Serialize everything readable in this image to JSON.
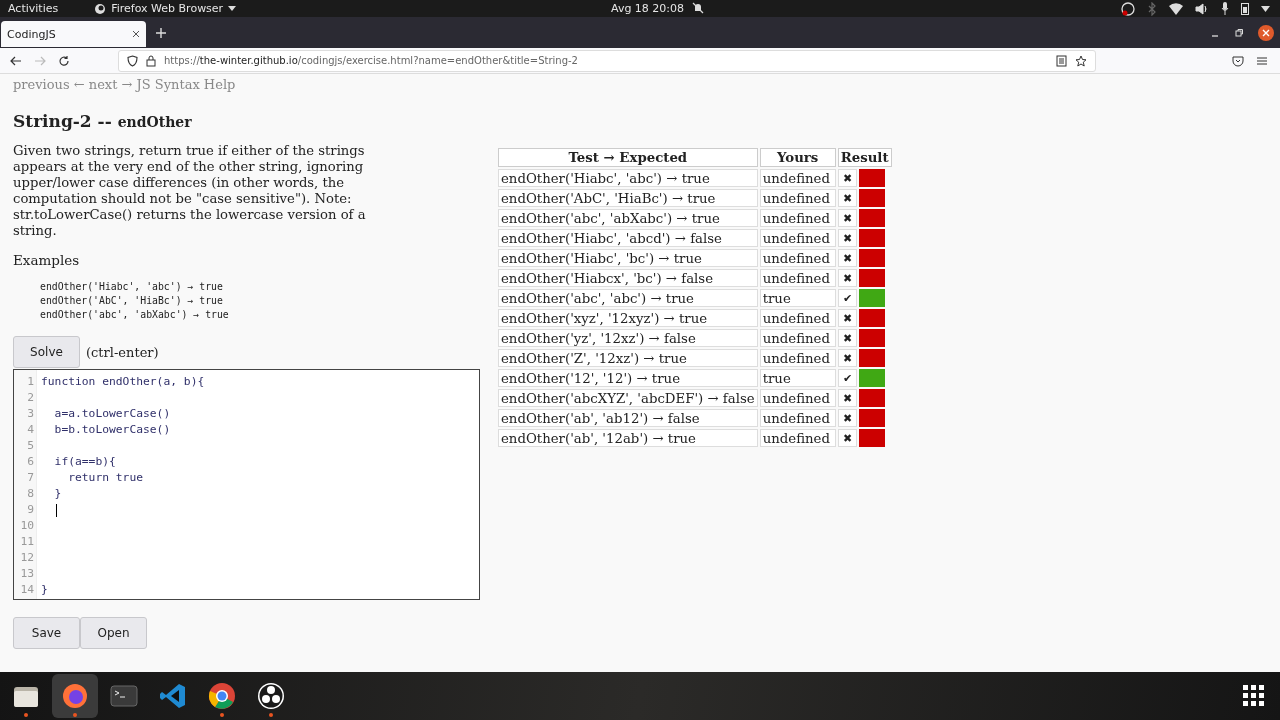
{
  "top_bar": {
    "activities": "Activities",
    "app_menu": "Firefox Web Browser",
    "clock": "Avg 18  20:08"
  },
  "browser": {
    "tabs": [
      {
        "title": "CodingJS",
        "selected": true
      }
    ],
    "url": {
      "scheme": "https://",
      "host": "the-winter.github.io",
      "path": "/codingjs/exercise.html?name=endOther&title=String-2"
    }
  },
  "page": {
    "nav": "previous ← next → JS Syntax Help",
    "title": "String-2 --",
    "title_name": "endOther",
    "description": "Given two strings, return true if either of the strings appears at the very end of the other string, ignoring upper/lower case differences (in other words, the computation should not be \"case sensitive\"). Note: str.toLowerCase() returns the lowercase version of a string.",
    "examples_heading": "Examples",
    "examples": [
      "endOther('Hiabc', 'abc') → true",
      "endOther('AbC', 'HiaBc') → true",
      "endOther('abc', 'abXabc') → true"
    ],
    "solve_button": "Solve",
    "solve_hint": "(ctrl-enter)",
    "editor": {
      "lines": [
        {
          "number": "1",
          "text": "function endOther(a, b){"
        },
        {
          "number": "2"
        },
        {
          "number": "3",
          "text": "  a=a.toLowerCase()"
        },
        {
          "number": "4",
          "text": "  b=b.toLowerCase()"
        },
        {
          "number": "5"
        },
        {
          "number": "6",
          "text": "  if(a==b){"
        },
        {
          "number": "7",
          "text": "    return true"
        },
        {
          "number": "8",
          "text": "  }"
        },
        {
          "number": "9",
          "cursor": true
        },
        {
          "number": "10"
        },
        {
          "number": "11"
        },
        {
          "number": "12"
        },
        {
          "number": "13"
        },
        {
          "number": "14",
          "text": "}"
        }
      ]
    },
    "buttons": [
      "Save",
      "Open"
    ],
    "table": {
      "columns": [
        "Test → Expected",
        "Yours",
        "Result"
      ],
      "rows": [
        {
          "test": "endOther('Hiabc', 'abc') → true",
          "yours": "undefined",
          "mark": "✖",
          "passed": false
        },
        {
          "test": "endOther('AbC', 'HiaBc') → true",
          "yours": "undefined",
          "mark": "✖",
          "passed": false
        },
        {
          "test": "endOther('abc', 'abXabc') → true",
          "yours": "undefined",
          "mark": "✖",
          "passed": false
        },
        {
          "test": "endOther('Hiabc', 'abcd') → false",
          "yours": "undefined",
          "mark": "✖",
          "passed": false
        },
        {
          "test": "endOther('Hiabc', 'bc') → true",
          "yours": "undefined",
          "mark": "✖",
          "passed": false
        },
        {
          "test": "endOther('Hiabcx', 'bc') → false",
          "yours": "undefined",
          "mark": "✖",
          "passed": false
        },
        {
          "test": "endOther('abc', 'abc') → true",
          "yours": "true",
          "mark": "✔",
          "passed": true
        },
        {
          "test": "endOther('xyz', '12xyz') → true",
          "yours": "undefined",
          "mark": "✖",
          "passed": false
        },
        {
          "test": "endOther('yz', '12xz') → false",
          "yours": "undefined",
          "mark": "✖",
          "passed": false
        },
        {
          "test": "endOther('Z', '12xz') → true",
          "yours": "undefined",
          "mark": "✖",
          "passed": false
        },
        {
          "test": "endOther('12', '12') → true",
          "yours": "true",
          "mark": "✔",
          "passed": true
        },
        {
          "test": "endOther('abcXYZ', 'abcDEF') → false",
          "yours": "undefined",
          "mark": "✖",
          "passed": false
        },
        {
          "test": "endOther('ab', 'ab12') → false",
          "yours": "undefined",
          "mark": "✖",
          "passed": false
        },
        {
          "test": "endOther('ab', '12ab') → true",
          "yours": "undefined",
          "mark": "✖",
          "passed": false
        }
      ]
    }
  },
  "dock": [
    {
      "kind": "files",
      "selected": false,
      "running": true
    },
    {
      "kind": "firefox",
      "selected": true,
      "running": true
    },
    {
      "kind": "terminal",
      "selected": false,
      "running": false
    },
    {
      "kind": "vscode",
      "selected": false,
      "running": false
    },
    {
      "kind": "chrome",
      "selected": false,
      "running": true
    },
    {
      "kind": "obs",
      "selected": false,
      "running": true
    }
  ]
}
